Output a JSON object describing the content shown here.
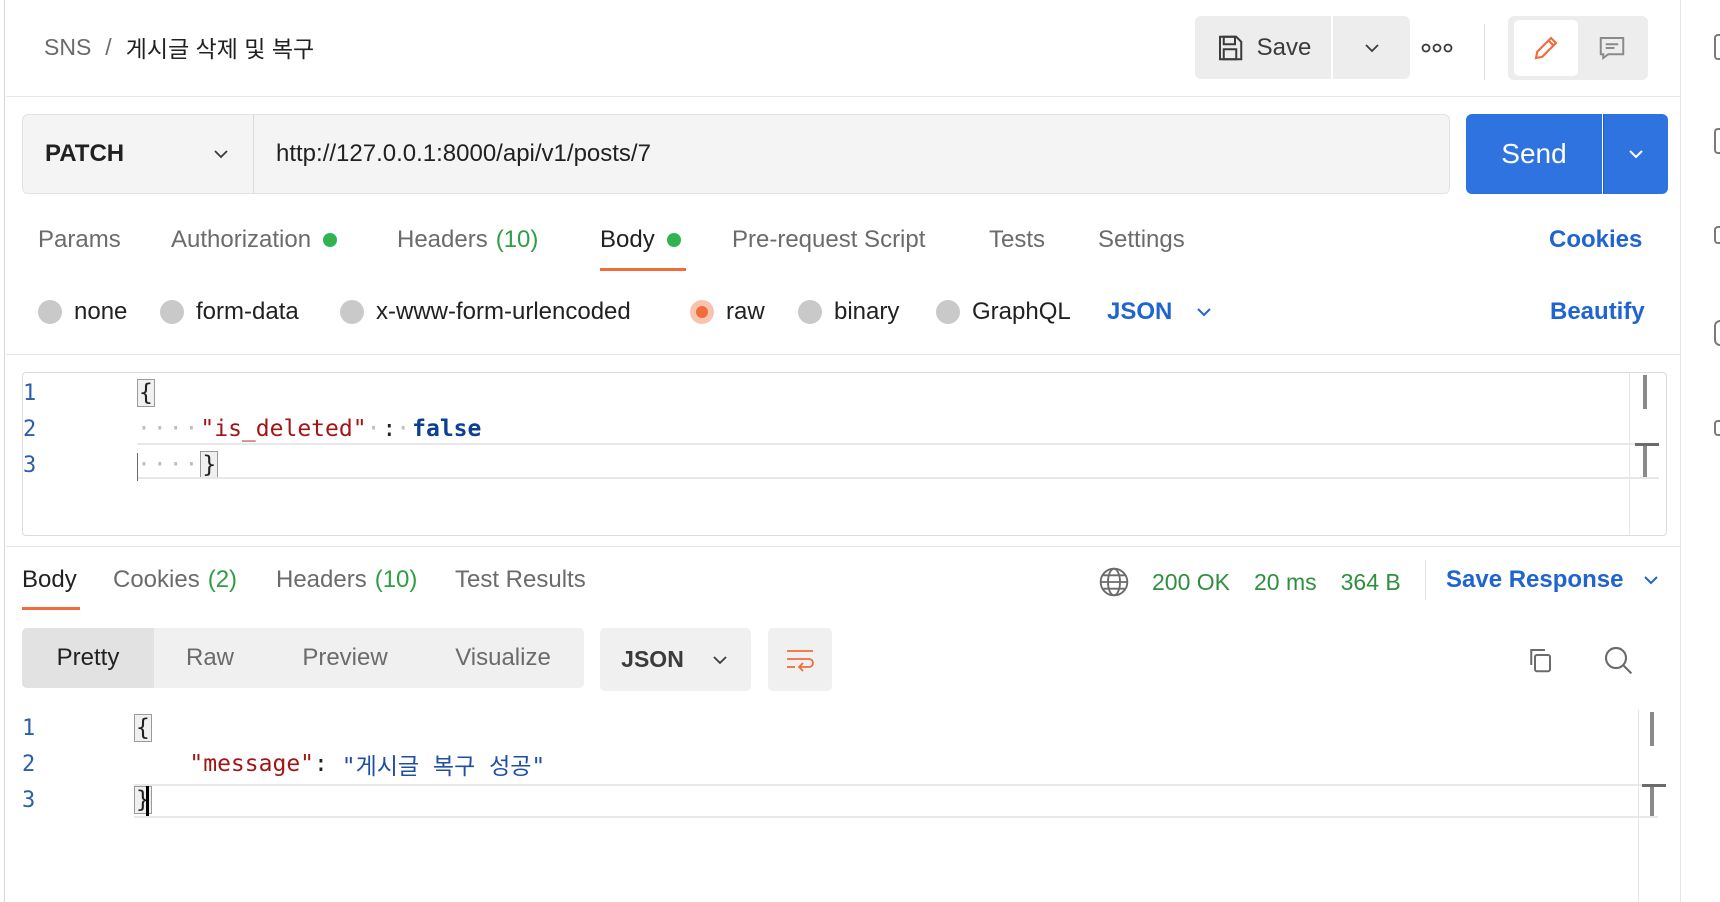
{
  "breadcrumb": {
    "root": "SNS",
    "separator": "/",
    "current": "게시글 삭제 및 복구"
  },
  "toolbar": {
    "save_label": "Save"
  },
  "request": {
    "method": "PATCH",
    "url": "http://127.0.0.1:8000/api/v1/posts/7",
    "send_label": "Send"
  },
  "request_tabs": {
    "params": "Params",
    "authorization": "Authorization",
    "headers": "Headers",
    "headers_count": "(10)",
    "body": "Body",
    "pre_request": "Pre-request Script",
    "tests": "Tests",
    "settings": "Settings",
    "cookies": "Cookies",
    "active": "Body"
  },
  "body_types": {
    "none": "none",
    "form_data": "form-data",
    "urlencoded": "x-www-form-urlencoded",
    "raw": "raw",
    "binary": "binary",
    "graphql": "GraphQL",
    "selected": "raw",
    "language": "JSON",
    "beautify": "Beautify"
  },
  "request_body": {
    "lines": [
      "1",
      "2",
      "3"
    ],
    "open_brace": "{",
    "key": "\"is_deleted\"",
    "colon": ":",
    "value": "false",
    "close_brace": "}"
  },
  "response_tabs": {
    "body": "Body",
    "cookies": "Cookies",
    "cookies_count": "(2)",
    "headers": "Headers",
    "headers_count": "(10)",
    "test_results": "Test Results",
    "active": "Body"
  },
  "response_status": {
    "status": "200 OK",
    "time": "20 ms",
    "size": "364 B",
    "save_response": "Save Response"
  },
  "response_view": {
    "pretty": "Pretty",
    "raw": "Raw",
    "preview": "Preview",
    "visualize": "Visualize",
    "format": "JSON",
    "active": "Pretty"
  },
  "response_body": {
    "lines": [
      "1",
      "2",
      "3"
    ],
    "open_brace": "{",
    "key": "\"message\"",
    "colon": ":",
    "value": "\"게시글 복구 성공\"",
    "close_brace": "}"
  },
  "colors": {
    "accent_blue": "#2e73e0",
    "link_blue": "#1f64d1",
    "active_orange": "#f26b3a",
    "status_green": "#2f8f3f"
  },
  "icons": {
    "save": "floppy-disk-icon",
    "more": "ellipsis-icon",
    "edit": "pencil-icon",
    "comment": "comment-icon",
    "globe": "globe-icon",
    "wrap": "text-wrap-icon",
    "copy": "copy-icon",
    "search": "search-icon"
  }
}
